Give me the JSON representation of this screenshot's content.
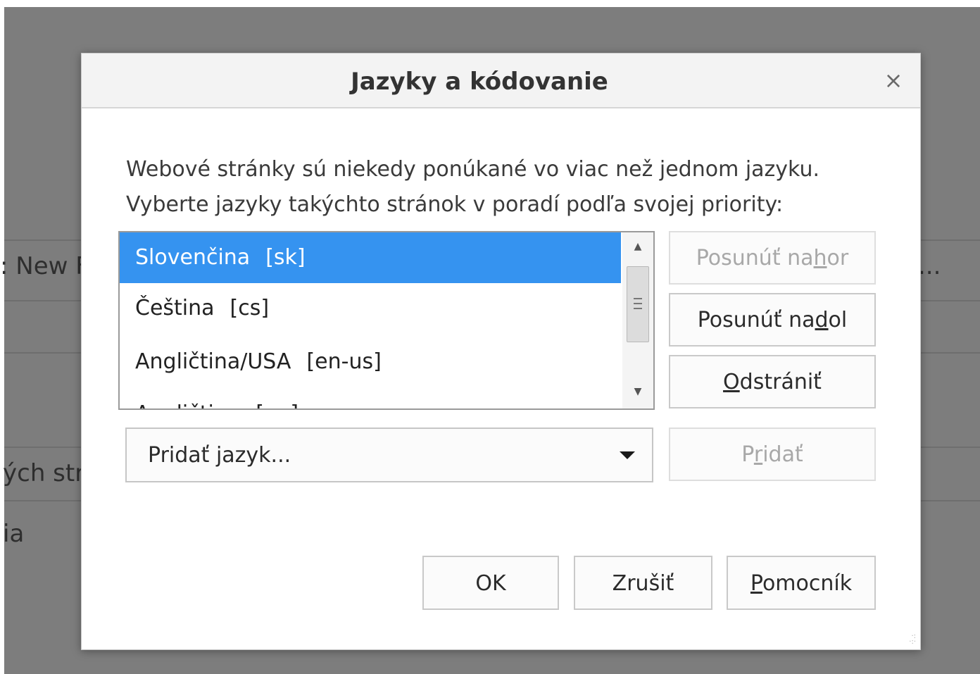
{
  "background": {
    "fragments": [
      ": New F",
      "...",
      "ých str",
      "ia"
    ]
  },
  "dialog": {
    "title": "Jazyky a kódovanie",
    "close_glyph": "×",
    "description_lines": [
      "Webové stránky sú niekedy ponúkané vo viac než jednom jazyku.",
      "Vyberte jazyky takýchto stránok v poradí podľa svojej priority:"
    ],
    "languages": [
      {
        "name": "Slovenčina",
        "code": "[sk]",
        "selected": true
      },
      {
        "name": "Čeština",
        "code": "[cs]",
        "selected": false
      },
      {
        "name": "Angličtina/USA",
        "code": "[en-us]",
        "selected": false
      },
      {
        "name": "Angličtina",
        "code": "[en]",
        "selected": false
      }
    ],
    "buttons": {
      "move_up": {
        "pre": "Posunúť na",
        "key": "h",
        "post": "or",
        "disabled": true
      },
      "move_down": {
        "pre": "Posunúť na",
        "key": "d",
        "post": "ol",
        "disabled": false
      },
      "remove": {
        "pre": "",
        "key": "O",
        "post": "dstrániť",
        "disabled": false
      },
      "add": {
        "pre": "P",
        "key": "r",
        "post": "idať",
        "disabled": true
      },
      "ok": "OK",
      "cancel": "Zrušiť",
      "help": {
        "key": "P",
        "post": "omocník"
      }
    },
    "add_language_select": {
      "value": "Pridať jazyk..."
    }
  },
  "colors": {
    "selection": "#3593f0",
    "overlay": "#7d7d7d"
  },
  "icons": {
    "close": "close-icon",
    "dropdown": "chevron-down-icon",
    "scroll_up": "scroll-up-icon",
    "scroll_down": "scroll-down-icon",
    "resize": "resize-grip-icon"
  }
}
